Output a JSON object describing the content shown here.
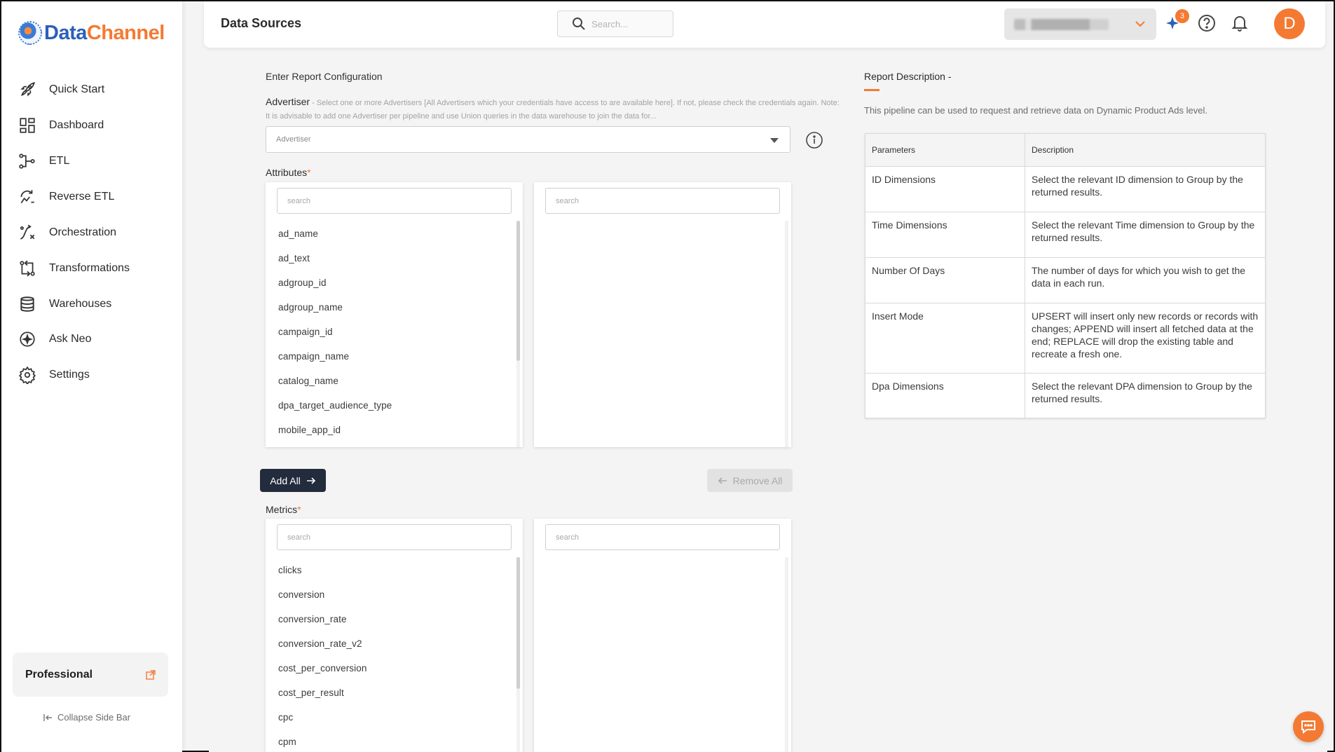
{
  "brand": {
    "name_part1": "Data",
    "name_part2": "Channel"
  },
  "sidebar": {
    "items": [
      {
        "label": "Quick Start",
        "icon": "rocket-icon"
      },
      {
        "label": "Dashboard",
        "icon": "dashboard-icon"
      },
      {
        "label": "ETL",
        "icon": "etl-icon"
      },
      {
        "label": "Reverse ETL",
        "icon": "reverse-etl-icon"
      },
      {
        "label": "Orchestration",
        "icon": "orchestration-icon"
      },
      {
        "label": "Transformations",
        "icon": "transformations-icon"
      },
      {
        "label": "Warehouses",
        "icon": "warehouse-icon"
      },
      {
        "label": "Ask Neo",
        "icon": "sparkle-icon"
      },
      {
        "label": "Settings",
        "icon": "gear-icon"
      }
    ],
    "plan": "Professional",
    "collapse": "Collapse Side Bar"
  },
  "header": {
    "title": "Data Sources",
    "search_placeholder": "Search...",
    "notification_count": "3",
    "avatar_initial": "D"
  },
  "config": {
    "heading": "Enter Report Configuration",
    "advertiser_label": "Advertiser",
    "advertiser_help": " - Select one or more Advertisers [All Advertisers which your credentials have access to are available here]. If not, please check the credentials again. Note: It is advisable to add one Advertiser per pipeline and use Union queries in the data warehouse to join the data for...",
    "advertiser_placeholder": "Advertiser",
    "attributes_label": "Attributes",
    "attributes_search_placeholder": "search",
    "attributes": [
      "ad_name",
      "ad_text",
      "adgroup_id",
      "adgroup_name",
      "campaign_id",
      "campaign_name",
      "catalog_name",
      "dpa_target_audience_type",
      "mobile_app_id"
    ],
    "add_all": "Add All",
    "remove_all": "Remove All",
    "metrics_label": "Metrics",
    "metrics_search_placeholder": "search",
    "metrics": [
      "clicks",
      "conversion",
      "conversion_rate",
      "conversion_rate_v2",
      "cost_per_conversion",
      "cost_per_result",
      "cpc",
      "cpm"
    ]
  },
  "report": {
    "title": "Report Description -",
    "description": "This pipeline can be used to request and retrieve data on Dynamic Product Ads level.",
    "col_params": "Parameters",
    "col_desc": "Description",
    "rows": [
      {
        "param": "ID Dimensions",
        "desc": "Select the relevant ID dimension to Group by the returned results."
      },
      {
        "param": "Time Dimensions",
        "desc": "Select the relevant Time dimension to Group by the returned results."
      },
      {
        "param": "Number Of Days",
        "desc": "The number of days for which you wish to get the data in each run."
      },
      {
        "param": "Insert Mode",
        "desc": "UPSERT will insert only new records or records with changes; APPEND will insert all fetched data at the end; REPLACE will drop the existing table and recreate a fresh one."
      },
      {
        "param": "Dpa Dimensions",
        "desc": "Select the relevant DPA dimension to Group by the returned results."
      }
    ]
  },
  "colors": {
    "accent": "#f47a33",
    "primary_button": "#222c3c",
    "brand_blue": "#2c5fb8"
  }
}
